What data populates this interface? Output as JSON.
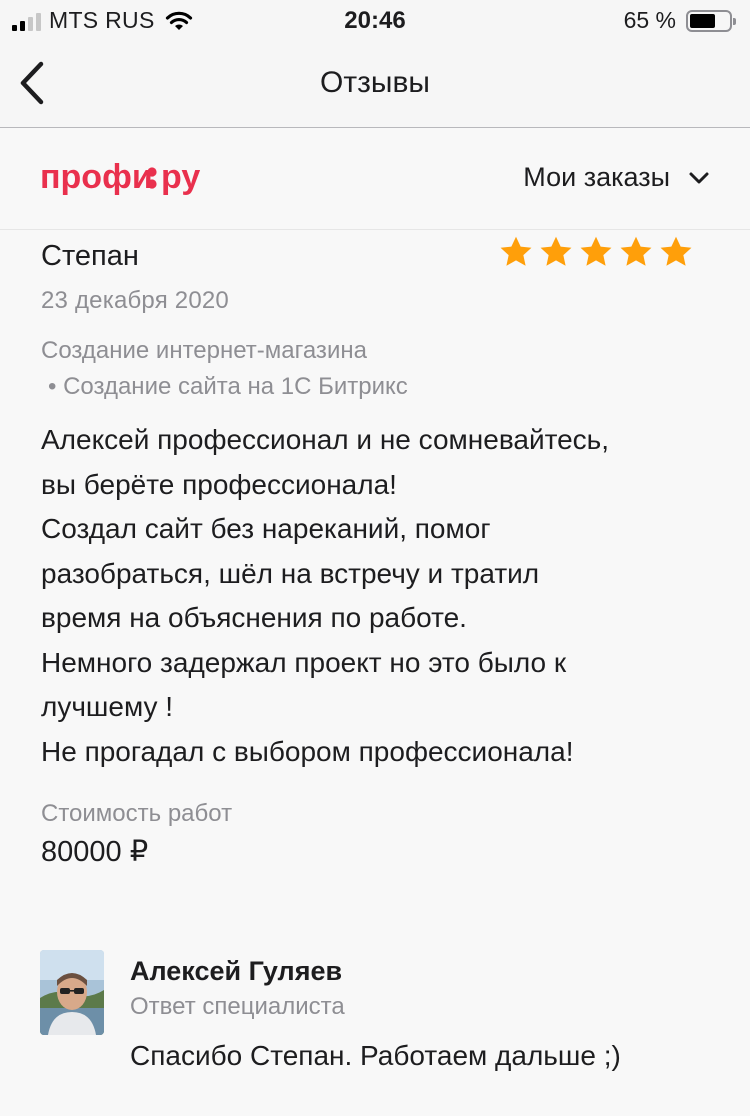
{
  "status_bar": {
    "carrier": "MTS RUS",
    "time": "20:46",
    "battery_percent": "65 %",
    "battery_level": 0.65
  },
  "nav": {
    "title": "Отзывы",
    "back_icon": "chevron-left-icon"
  },
  "header": {
    "logo_text": "профи.ру",
    "menu_label": "Мои заказы",
    "menu_icon": "chevron-down-icon",
    "brand_color": "#e9304d"
  },
  "review": {
    "author": "Степан",
    "rating": 5,
    "rating_max": 5,
    "star_color": "#ff9f0a",
    "date": "23 декабря 2020",
    "service": "Создание интернет-магазина",
    "subservice": "• Создание сайта на 1С Битрикс",
    "text": "Алексей профессионал и не сомневайтесь,\nвы берёте профессионала!\nСоздал сайт без нареканий, помог\nразобраться, шёл на встречу и тратил\nвремя на объяснения по работе.\nНемного задержал проект но это было к\nлучшему !\nНе прогадал с выбором профессионала!",
    "cost_label": "Стоимость работ",
    "cost_value": "80000 ₽"
  },
  "reply": {
    "name": "Алексей Гуляев",
    "role": "Ответ специалиста",
    "text": "Спасибо Степан. Работаем дальше ;)"
  }
}
